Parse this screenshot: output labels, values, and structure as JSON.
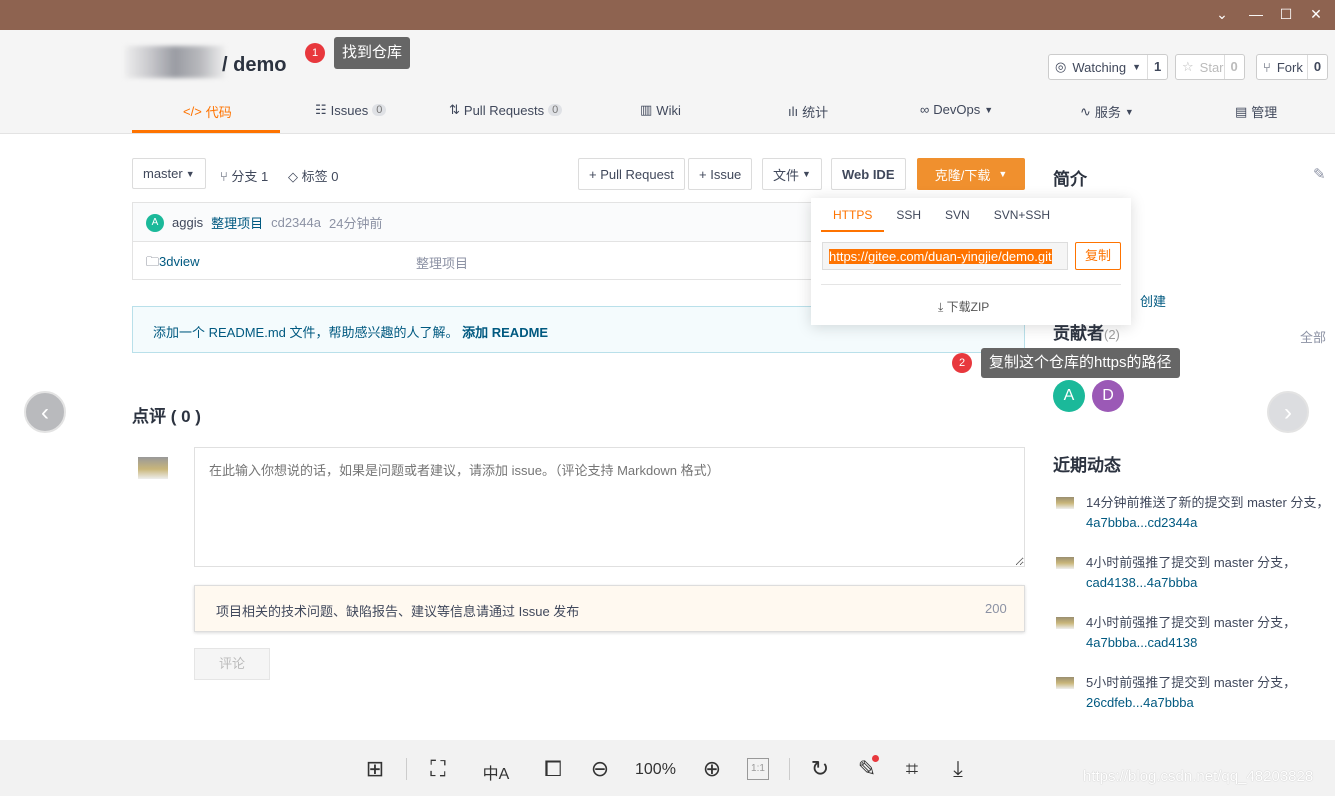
{
  "window": {
    "controls": [
      "chevron-down",
      "minimize",
      "maximize",
      "close"
    ]
  },
  "repo": {
    "name": "/ demo"
  },
  "annotations": [
    {
      "num": "1",
      "text": "找到仓库"
    },
    {
      "num": "2",
      "text": "复制这个仓库的https的路径"
    }
  ],
  "header_buttons": {
    "watch": {
      "label": "Watching",
      "count": "1"
    },
    "star": {
      "label": "Star",
      "count": "0"
    },
    "fork": {
      "label": "Fork",
      "count": "0"
    }
  },
  "tabs": [
    {
      "label": "代码",
      "icon": "code-icon"
    },
    {
      "label": "Issues",
      "count": "0"
    },
    {
      "label": "Pull Requests",
      "count": "0"
    },
    {
      "label": "Wiki"
    },
    {
      "label": "统计"
    },
    {
      "label": "DevOps"
    },
    {
      "label": "服务"
    },
    {
      "label": "管理"
    }
  ],
  "toolbar": {
    "branch": "master",
    "branches": "分支 1",
    "tags": "标签 0",
    "pull_request": "+ Pull Request",
    "issue": "+ Issue",
    "file": "文件",
    "web_ide": "Web IDE",
    "clone": "克隆/下载"
  },
  "commit": {
    "avatar": "A",
    "author": "aggis",
    "message": "整理项目",
    "hash": "cd2344a",
    "time": "24分钟前"
  },
  "files": [
    {
      "name": "3dview",
      "message": "整理项目"
    }
  ],
  "readme_notice": {
    "text": "添加一个 README.md 文件，帮助感兴趣的人了解。",
    "link": "添加 README"
  },
  "clone_dropdown": {
    "tabs": [
      "HTTPS",
      "SSH",
      "SVN",
      "SVN+SSH"
    ],
    "url": "https://gitee.com/duan-yingjie/demo.git",
    "copy": "复制",
    "download_zip": "下载ZIP"
  },
  "comments": {
    "title": "点评 ( 0 )",
    "placeholder": "在此输入你想说的话，如果是问题或者建议，请添加 issue。（评论支持 Markdown 格式）",
    "notice": "项目相关的技术问题、缺陷报告、建议等信息请通过 Issue 发布",
    "notice_count": "200",
    "submit": "评论"
  },
  "sidebar": {
    "intro_title": "简介",
    "created": "创建",
    "contributors_title": "贡献者",
    "contributors_count": "(2)",
    "all": "全部",
    "contributors": [
      {
        "initial": "A",
        "color": "#1bb99a"
      },
      {
        "initial": "D",
        "color": "#9b59b6"
      }
    ],
    "activity_title": "近期动态",
    "activities": [
      {
        "text": "14分钟前推送了新的提交到 master 分支，",
        "link": "4a7bbba...cd2344a"
      },
      {
        "text": "4小时前强推了提交到 master 分支，",
        "link": "cad4138...4a7bbba"
      },
      {
        "text": "4小时前强推了提交到 master 分支，",
        "link": "4a7bbba...cad4138"
      },
      {
        "text": "5小时前强推了提交到 master 分支，",
        "link": "26cdfeb...4a7bbba"
      }
    ]
  },
  "viewer": {
    "zoom": "100%",
    "one_to_one": "1:1",
    "watermark": "https://blog.csdn.net/qq_48203828"
  },
  "colors": {
    "accent": "#fe7300",
    "clone_button": "#f0902e",
    "titlebar": "#8e6350"
  }
}
